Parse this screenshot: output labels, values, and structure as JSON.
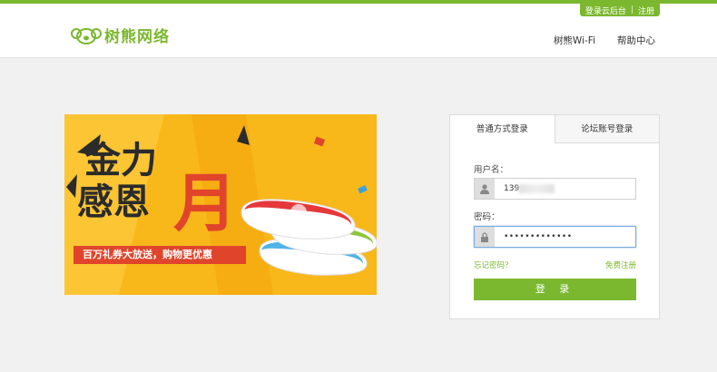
{
  "header": {
    "top_links": {
      "console": "登录云后台",
      "register": "注册"
    },
    "logo_text": "树熊网络",
    "nav": [
      "树熊Wi-Fi",
      "帮助中心"
    ]
  },
  "banner": {
    "headline_line1": "金力",
    "headline_line2": "感恩",
    "headline_big": "月",
    "slogan": "百万礼券大放送，购物更优惠"
  },
  "login": {
    "tabs": {
      "standard": "普通方式登录",
      "forum": "论坛账号登录"
    },
    "username_label": "用户名：",
    "username_value": "139",
    "password_label": "密码：",
    "password_value": "•••••••••••••",
    "forgot": "忘记密码？",
    "free_register": "免费注册",
    "submit": "登 录"
  },
  "colors": {
    "brand": "#7cb82f",
    "banner_bg": "#f8b81a",
    "slogan_bg": "#e0452c"
  }
}
